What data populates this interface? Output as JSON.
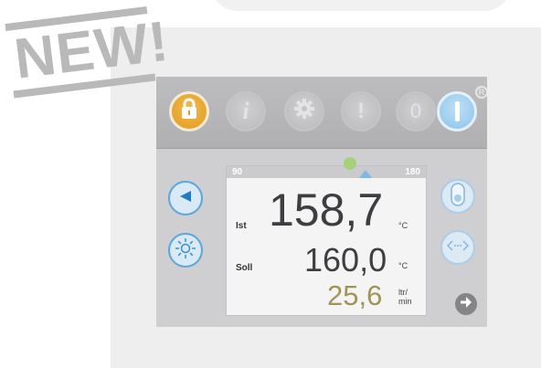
{
  "stamp": {
    "text": "NEW!"
  },
  "topbar": {
    "info_icon": "i",
    "alert_icon": "!",
    "zero_label": "0",
    "registered": "R"
  },
  "display": {
    "scale_min": "90",
    "scale_max": "180",
    "actual_label": "Ist",
    "actual_value": "158,7",
    "actual_unit": "°C",
    "setpoint_label": "Soll",
    "setpoint_value": "160,0",
    "setpoint_unit": "°C",
    "flow_value": "25,6",
    "flow_unit_top": "ltr/",
    "flow_unit_bottom": "min"
  },
  "colors": {
    "lock_accent": "#e9a02a",
    "power_accent": "#8cc3ea",
    "flow_value": "#a39357",
    "side_button_border": "#5aa6de",
    "setpoint_marker": "#7cb9e8",
    "actual_marker": "#a7d07c"
  },
  "icons": {
    "lock": "lock-icon",
    "info": "info-icon",
    "gear": "gear-icon",
    "alert": "alert-icon",
    "power": "power-icon",
    "play": "play-icon",
    "light": "sun-icon",
    "toggle": "toggle-icon",
    "transfer": "transfer-icon",
    "next": "arrow-right-icon"
  }
}
